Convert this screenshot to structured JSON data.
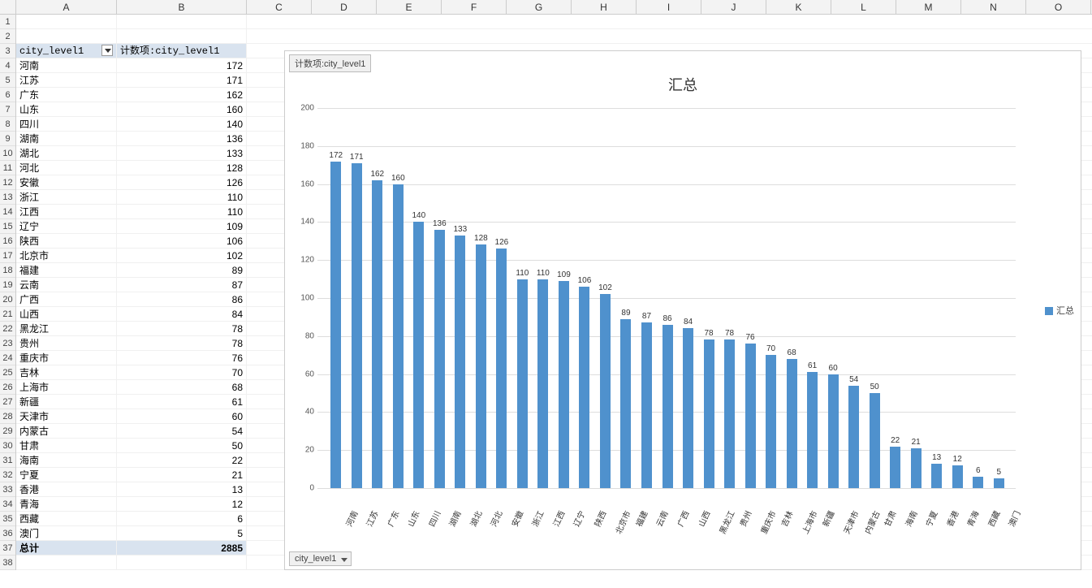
{
  "columns": [
    "A",
    "B",
    "C",
    "D",
    "E",
    "F",
    "G",
    "H",
    "I",
    "J",
    "K",
    "L",
    "M",
    "N",
    "O"
  ],
  "row_count": 38,
  "pivot": {
    "header_row": 3,
    "field_label": "city_level1",
    "value_label": "计数项:city_level1",
    "total_label": "总计",
    "total_value": 2885,
    "rows": [
      {
        "name": "河南",
        "value": 172
      },
      {
        "name": "江苏",
        "value": 171
      },
      {
        "name": "广东",
        "value": 162
      },
      {
        "name": "山东",
        "value": 160
      },
      {
        "name": "四川",
        "value": 140
      },
      {
        "name": "湖南",
        "value": 136
      },
      {
        "name": "湖北",
        "value": 133
      },
      {
        "name": "河北",
        "value": 128
      },
      {
        "name": "安徽",
        "value": 126
      },
      {
        "name": "浙江",
        "value": 110
      },
      {
        "name": "江西",
        "value": 110
      },
      {
        "name": "辽宁",
        "value": 109
      },
      {
        "name": "陕西",
        "value": 106
      },
      {
        "name": "北京市",
        "value": 102
      },
      {
        "name": "福建",
        "value": 89
      },
      {
        "name": "云南",
        "value": 87
      },
      {
        "name": "广西",
        "value": 86
      },
      {
        "name": "山西",
        "value": 84
      },
      {
        "name": "黑龙江",
        "value": 78
      },
      {
        "name": "贵州",
        "value": 78
      },
      {
        "name": "重庆市",
        "value": 76
      },
      {
        "name": "吉林",
        "value": 70
      },
      {
        "name": "上海市",
        "value": 68
      },
      {
        "name": "新疆",
        "value": 61
      },
      {
        "name": "天津市",
        "value": 60
      },
      {
        "name": "内蒙古",
        "value": 54
      },
      {
        "name": "甘肃",
        "value": 50
      },
      {
        "name": "海南",
        "value": 22
      },
      {
        "name": "宁夏",
        "value": 21
      },
      {
        "name": "香港",
        "value": 13
      },
      {
        "name": "青海",
        "value": 12
      },
      {
        "name": "西藏",
        "value": 6
      },
      {
        "name": "澳门",
        "value": 5
      }
    ]
  },
  "chart_data": {
    "type": "bar",
    "title": "汇总",
    "series_button_label": "计数项:city_level1",
    "axis_button_label": "city_level1",
    "legend_label": "汇总",
    "ylim": [
      0,
      200
    ],
    "yticks": [
      0,
      20,
      40,
      60,
      80,
      100,
      120,
      140,
      160,
      180,
      200
    ],
    "categories": [
      "河南",
      "江苏",
      "广东",
      "山东",
      "四川",
      "湖南",
      "湖北",
      "河北",
      "安徽",
      "浙江",
      "江西",
      "辽宁",
      "陕西",
      "北京市",
      "福建",
      "云南",
      "广西",
      "山西",
      "黑龙江",
      "贵州",
      "重庆市",
      "吉林",
      "上海市",
      "新疆",
      "天津市",
      "内蒙古",
      "甘肃",
      "海南",
      "宁夏",
      "香港",
      "青海",
      "西藏",
      "澳门"
    ],
    "values": [
      172,
      171,
      162,
      160,
      140,
      136,
      133,
      128,
      126,
      110,
      110,
      109,
      106,
      102,
      89,
      87,
      86,
      84,
      78,
      78,
      76,
      70,
      68,
      61,
      60,
      54,
      50,
      22,
      21,
      13,
      12,
      6,
      5
    ],
    "xlabel": "",
    "ylabel": ""
  }
}
